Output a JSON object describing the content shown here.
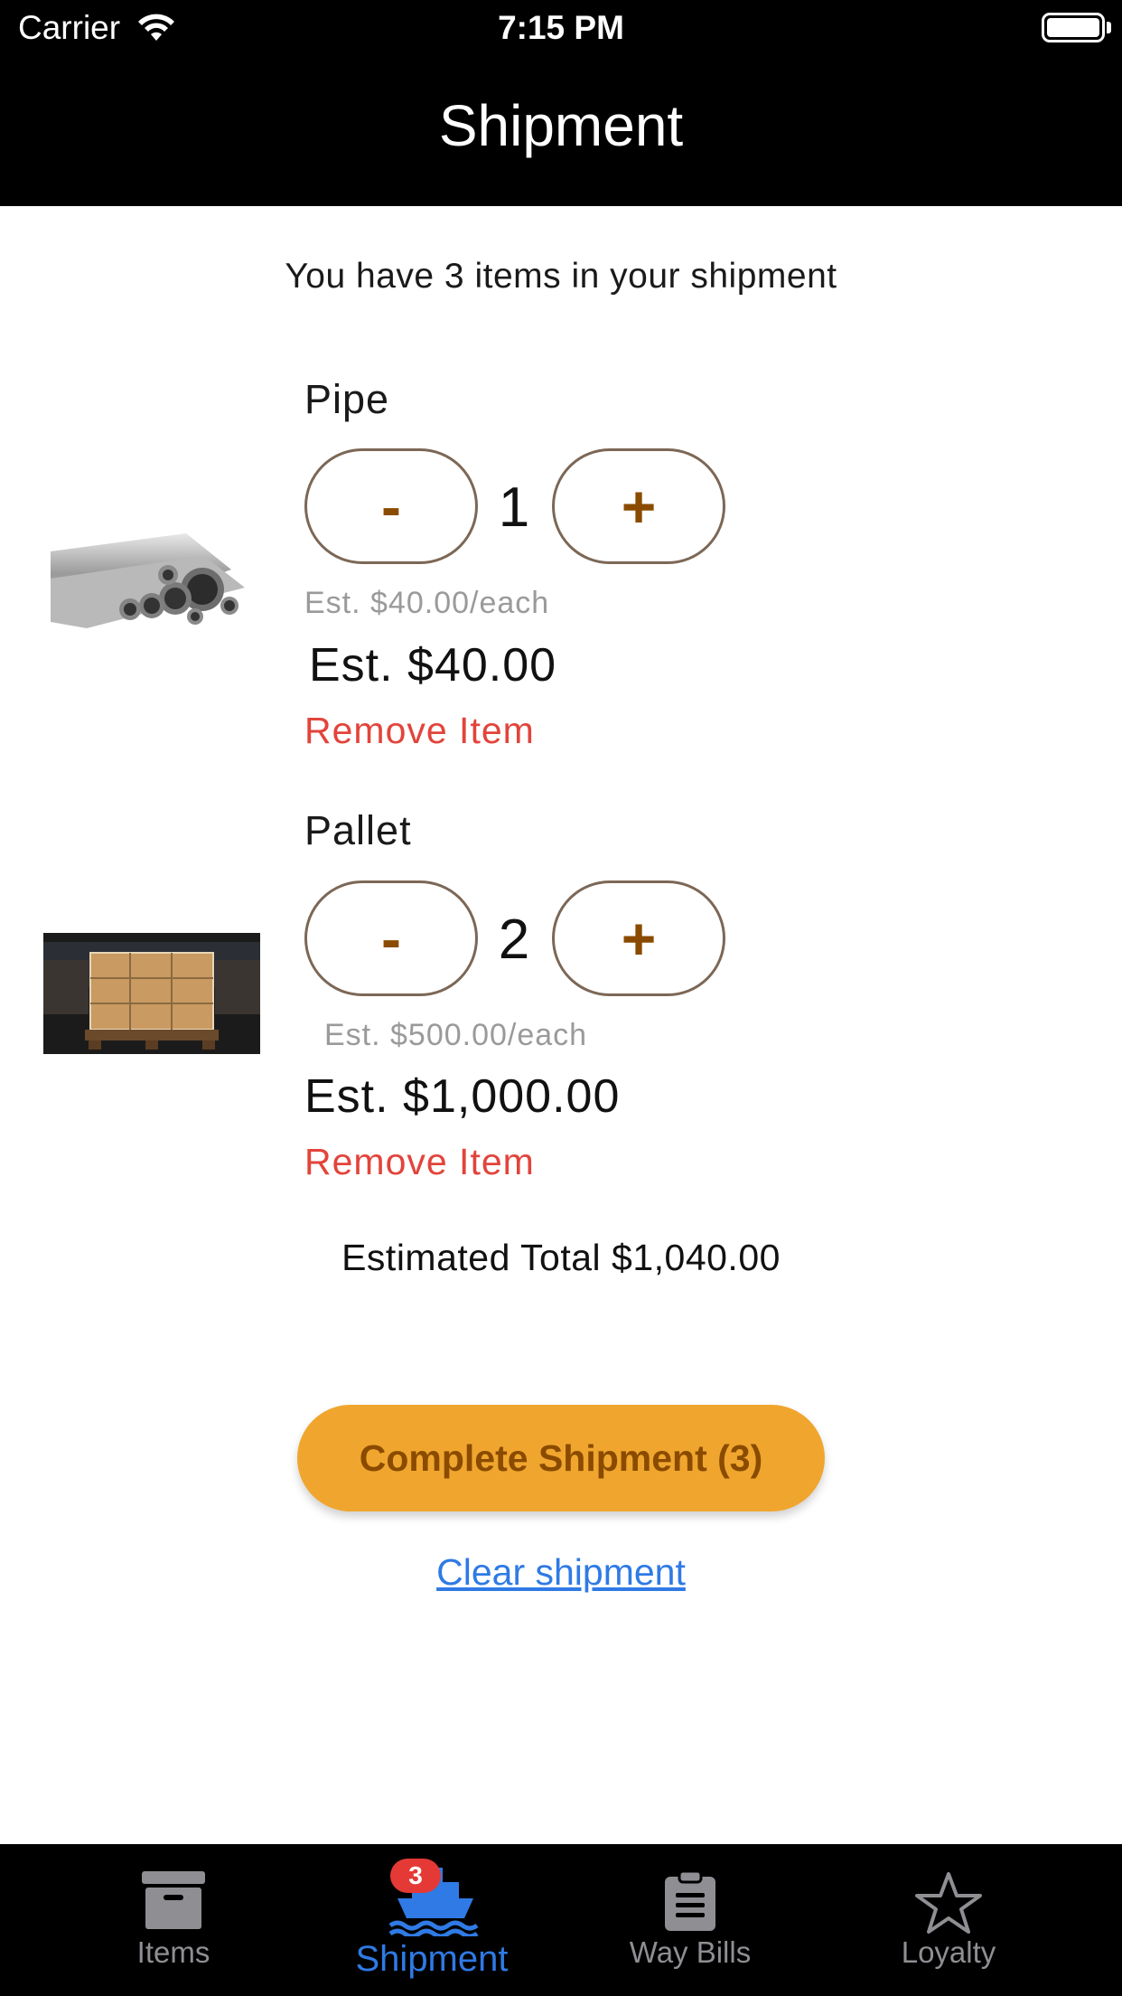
{
  "status_bar": {
    "carrier": "Carrier",
    "time": "7:15 PM"
  },
  "header": {
    "title": "Shipment"
  },
  "summary": "You have 3 items in your shipment",
  "items": [
    {
      "name": "Pipe",
      "quantity": "1",
      "minus": "-",
      "plus": "+",
      "each": "Est. $40.00/each",
      "total": "Est. $40.00",
      "remove": "Remove Item"
    },
    {
      "name": "Pallet",
      "quantity": "2",
      "minus": "-",
      "plus": "+",
      "each": "Est. $500.00/each",
      "total": "Est. $1,000.00",
      "remove": "Remove Item"
    }
  ],
  "estimated_total": "Estimated Total $1,040.00",
  "actions": {
    "complete": "Complete Shipment (3)",
    "clear": "Clear shipment"
  },
  "tabs": [
    {
      "label": "Items",
      "icon": "archive-box-icon"
    },
    {
      "label": "Shipment",
      "icon": "ship-icon",
      "badge": "3",
      "active": true
    },
    {
      "label": "Way Bills",
      "icon": "clipboard-icon"
    },
    {
      "label": "Loyalty",
      "icon": "star-icon"
    }
  ],
  "colors": {
    "accent": "#f0a62e",
    "accent_text": "#8a4b00",
    "remove": "#e2443b",
    "link": "#2f7ae5",
    "tab_active": "#2f7ae5",
    "tab_inactive": "#8e8e93"
  }
}
